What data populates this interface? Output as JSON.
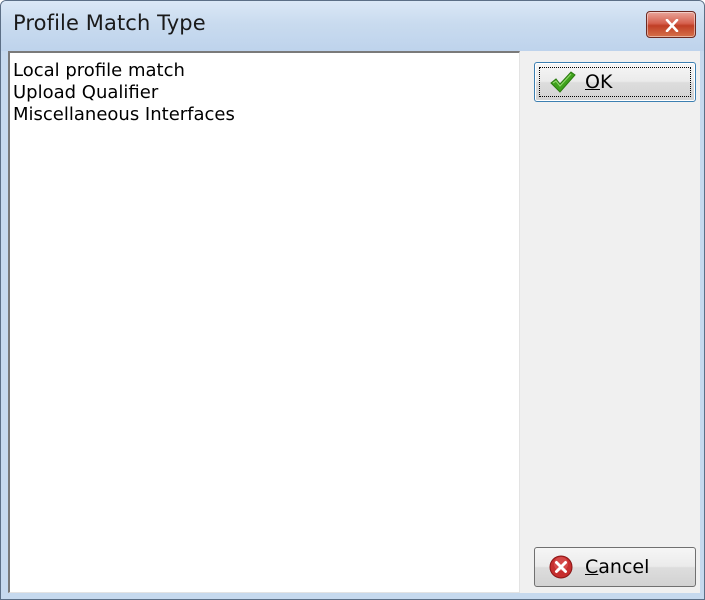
{
  "window": {
    "title": "Profile Match Type"
  },
  "list": {
    "items": [
      "Local profile match",
      "Upload Qualifier",
      "Miscellaneous Interfaces"
    ]
  },
  "buttons": {
    "ok": {
      "mnemonic": "O",
      "rest": "K",
      "icon": "checkmark-icon"
    },
    "cancel": {
      "mnemonic": "C",
      "rest": "ancel",
      "icon": "cancel-x-icon"
    }
  },
  "colors": {
    "title_bar": "#c6d9ee",
    "close_button": "#c8402c",
    "ok_check": "#3fa21c",
    "cancel_icon": "#c62e2e"
  }
}
